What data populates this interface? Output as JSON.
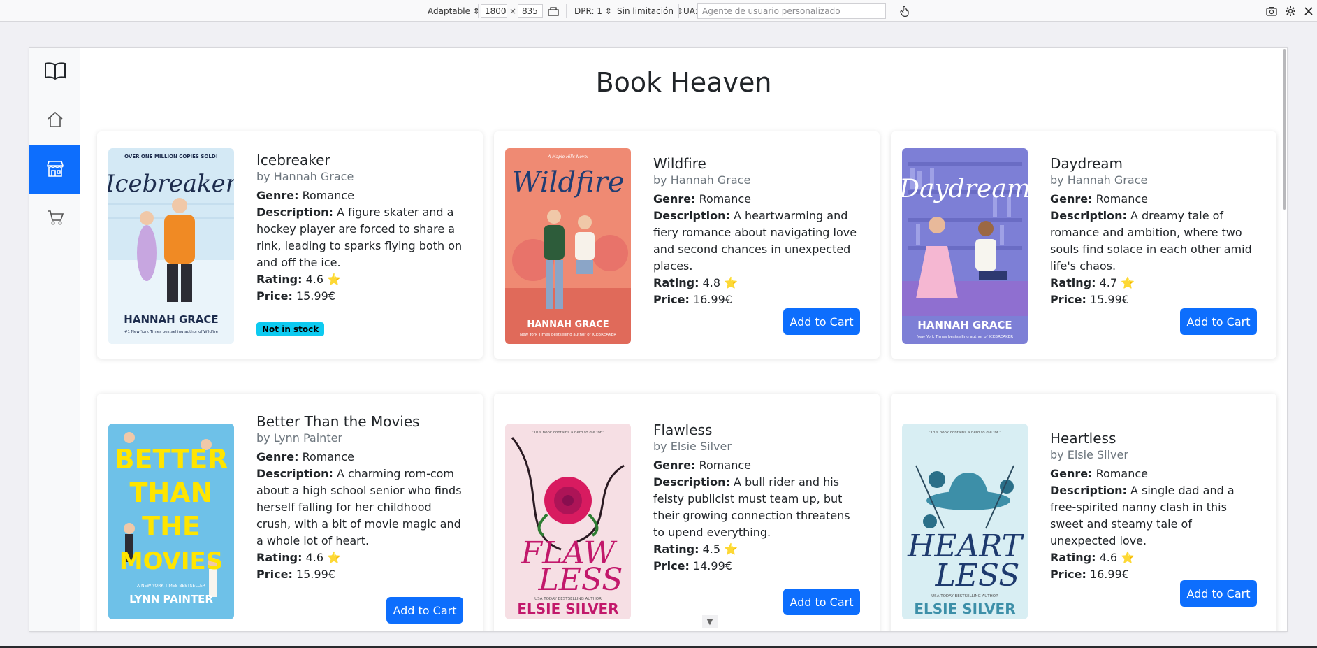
{
  "rdm": {
    "device": "Adaptable",
    "width": "1800",
    "times": "×",
    "height": "835",
    "dpr": "DPR: 1",
    "throttle": "Sin limitación",
    "ua_label": "UA:",
    "ua_placeholder": "Agente de usuario personalizado"
  },
  "sidebar": [
    "book-icon",
    "home-icon",
    "store-icon",
    "cart-icon"
  ],
  "page": {
    "title": "Book Heaven"
  },
  "labels": {
    "genre": "Genre:",
    "description": "Description:",
    "rating": "Rating:",
    "price": "Price:",
    "add_to_cart": "Add to Cart",
    "not_in_stock": "Not in stock",
    "star": "⭐"
  },
  "books": [
    {
      "title": "Icebreaker",
      "author": "by Hannah Grace",
      "genre": "Romance",
      "description": "A figure skater and a hockey player are forced to share a rink, leading to sparks flying both on and off the ice.",
      "rating": "4.6",
      "price": "15.99€",
      "in_stock": false,
      "cover": {
        "title": "Icebreaker",
        "author": "HANNAH GRACE",
        "top": "OVER ONE MILLION COPIES SOLD!",
        "bottom": "#1 New York Times bestselling author of Wildfire",
        "bg": "#cfe6f3",
        "color": "#1d2c4d"
      }
    },
    {
      "title": "Wildfire",
      "author": "by Hannah Grace",
      "genre": "Romance",
      "description": "A heartwarming and fiery romance about navigating love and second chances in unexpected places.",
      "rating": "4.8",
      "price": "16.99€",
      "in_stock": true,
      "cover": {
        "title": "Wildfire",
        "author": "HANNAH GRACE",
        "top": "A Maple Hills Novel",
        "bottom": "New York Times bestselling author of ICEBREAKER",
        "bg": "#ef8a73",
        "color": "#1f3d73"
      }
    },
    {
      "title": "Daydream",
      "author": "by Hannah Grace",
      "genre": "Romance",
      "description": "A dreamy tale of romance and ambition, where two souls find solace in each other amid life's chaos.",
      "rating": "4.7",
      "price": "15.99€",
      "in_stock": true,
      "cover": {
        "title": "Daydream",
        "author": "HANNAH GRACE",
        "top": "",
        "bottom": "New York Times bestselling author of ICEBREAKER",
        "bg": "#7d7fd6",
        "color": "#ffffff"
      }
    },
    {
      "title": "Better Than the Movies",
      "author": "by Lynn Painter",
      "genre": "Romance",
      "description": "A charming rom-com about a high school senior who finds herself falling for her childhood crush, with a bit of movie magic and a whole lot of heart.",
      "rating": "4.6",
      "price": "15.99€",
      "in_stock": true,
      "cover": {
        "title": "BETTER THAN THE MOVIES",
        "author": "LYNN PAINTER",
        "top": "",
        "bottom": "A NEW YORK TIMES BESTSELLER",
        "bg": "#6ec1e8",
        "color": "#ffe500"
      }
    },
    {
      "title": "Flawless",
      "author": "by Elsie Silver",
      "genre": "Romance",
      "description": "A bull rider and his feisty publicist must team up, but their growing connection threatens to upend everything.",
      "rating": "4.5",
      "price": "14.99€",
      "in_stock": true,
      "cover": {
        "title": "FLAW LESS",
        "author": "ELSIE SILVER",
        "top": "\"This book contains a hero to die for.\"",
        "bottom": "USA TODAY BESTSELLING AUTHOR",
        "bg": "#f6dfe4",
        "color": "#c2186b"
      }
    },
    {
      "title": "Heartless",
      "author": "by Elsie Silver",
      "genre": "Romance",
      "description": "A single dad and a free-spirited nanny clash in this sweet and steamy tale of unexpected love.",
      "rating": "4.6",
      "price": "16.99€",
      "in_stock": true,
      "cover": {
        "title": "HEART LESS",
        "author": "ELSIE SILVER",
        "top": "\"This book contains a hero to die for.\"",
        "bottom": "USA TODAY BESTSELLING AUTHOR",
        "bg": "#d8eef3",
        "color": "#1e3a6e"
      }
    }
  ]
}
